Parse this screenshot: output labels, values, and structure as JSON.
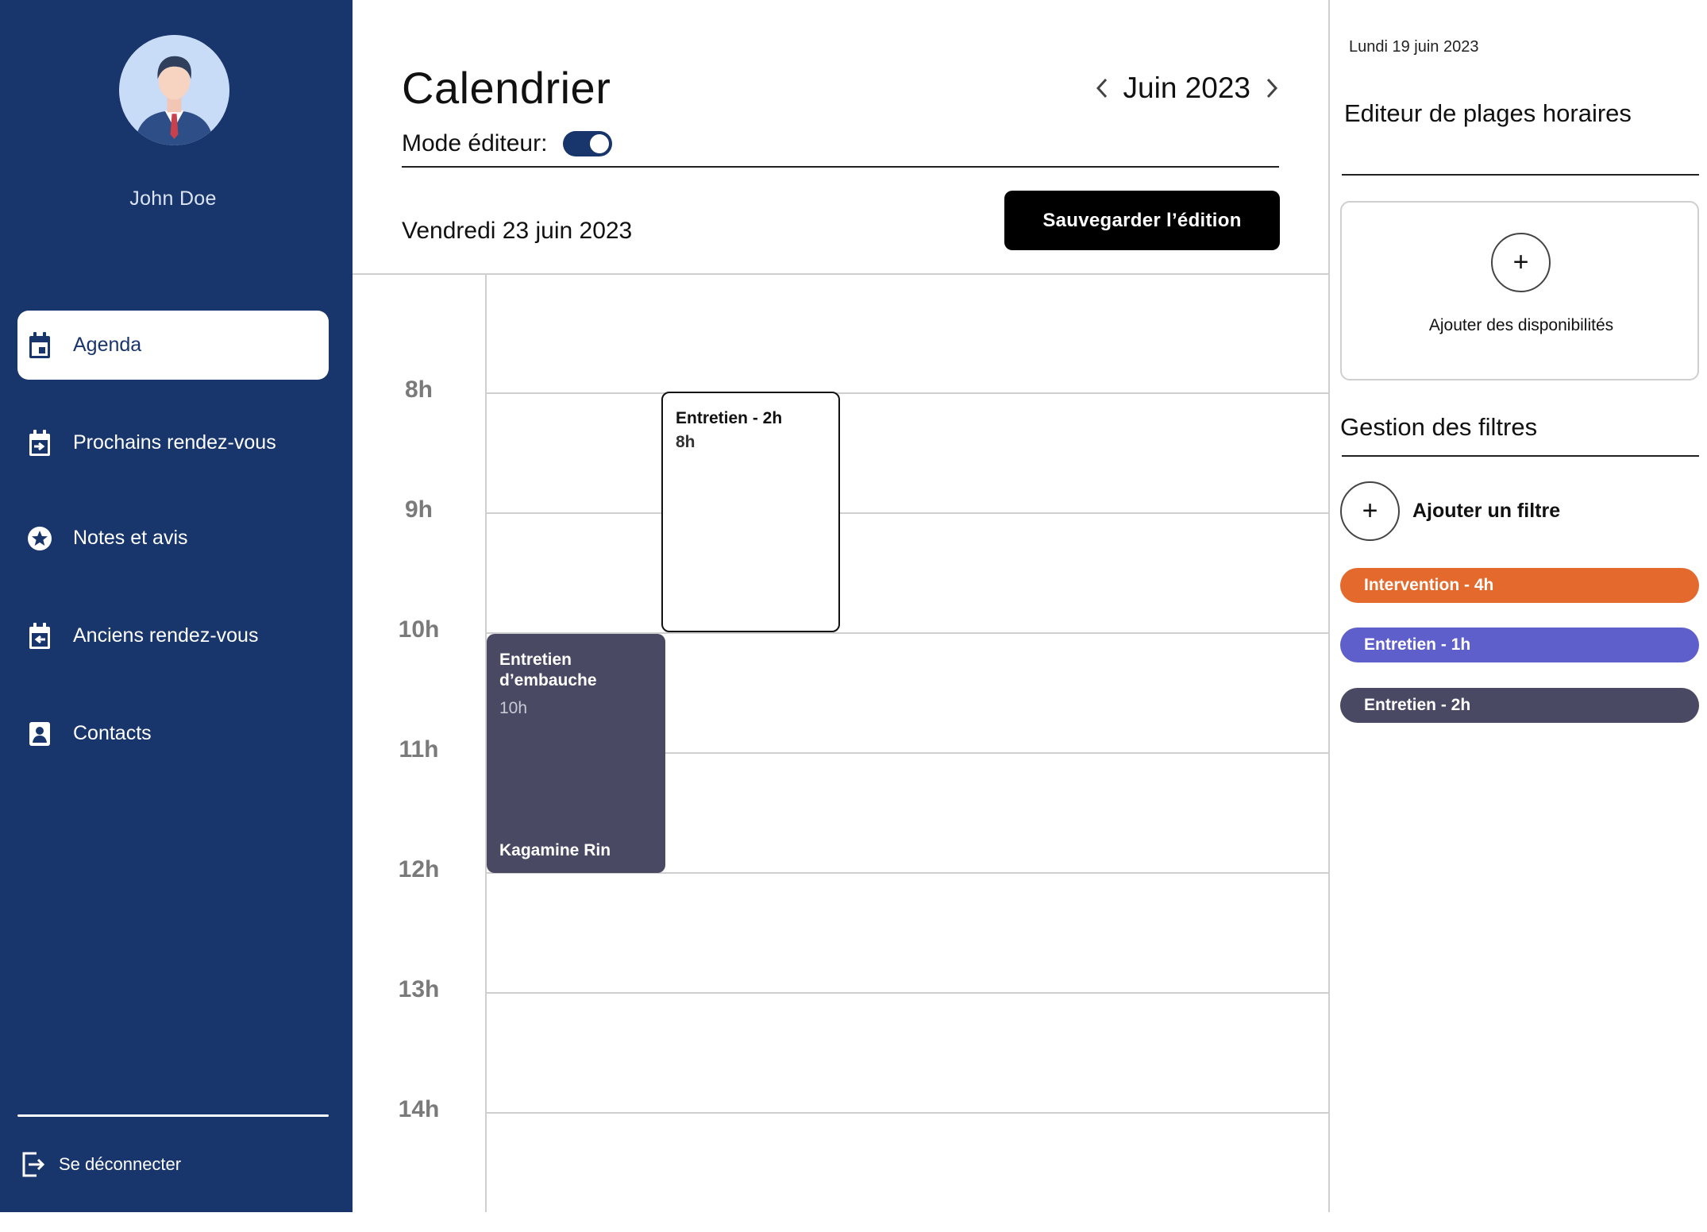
{
  "user": {
    "name": "John Doe"
  },
  "nav": {
    "items": [
      {
        "label": "Agenda",
        "icon": "calendar-icon"
      },
      {
        "label": "Prochains rendez-vous",
        "icon": "calendar-next-icon"
      },
      {
        "label": "Notes et avis",
        "icon": "star-badge-icon"
      },
      {
        "label": "Anciens rendez-vous",
        "icon": "calendar-previous-icon"
      },
      {
        "label": "Contacts",
        "icon": "contact-card-icon"
      }
    ],
    "active": "Agenda",
    "logout_label": "Se déconnecter"
  },
  "header": {
    "title": "Calendrier",
    "month": "Juin 2023",
    "editor_mode_label": "Mode éditeur:",
    "editor_mode_on": true,
    "day": "Vendredi 23 juin 2023",
    "save_label": "Sauvegarder l’édition"
  },
  "calendar": {
    "hours": [
      "8h",
      "9h",
      "10h",
      "11h",
      "12h",
      "13h",
      "14h"
    ],
    "events": [
      {
        "title": "Entretien - 2h",
        "time": "8h"
      },
      {
        "title": "Entretien d’embauche",
        "time": "10h",
        "person": "Kagamine Rin"
      }
    ]
  },
  "right_panel": {
    "date": "Lundi 19 juin 2023",
    "editor_title": "Editeur de plages horaires",
    "add_availability_label": "Ajouter des disponibilités",
    "filters_title": "Gestion des filtres",
    "add_filter_label": "Ajouter un filtre",
    "filters": [
      {
        "label": "Intervention - 4h",
        "color": "#e4692c"
      },
      {
        "label": "Entretien - 1h",
        "color": "#5f5fcb"
      },
      {
        "label": "Entretien - 2h",
        "color": "#4a4964"
      }
    ]
  },
  "colors": {
    "sidebar": "#18366c",
    "accent": "#18366c",
    "save_button": "#000000",
    "event_filled": "#4a4964"
  }
}
